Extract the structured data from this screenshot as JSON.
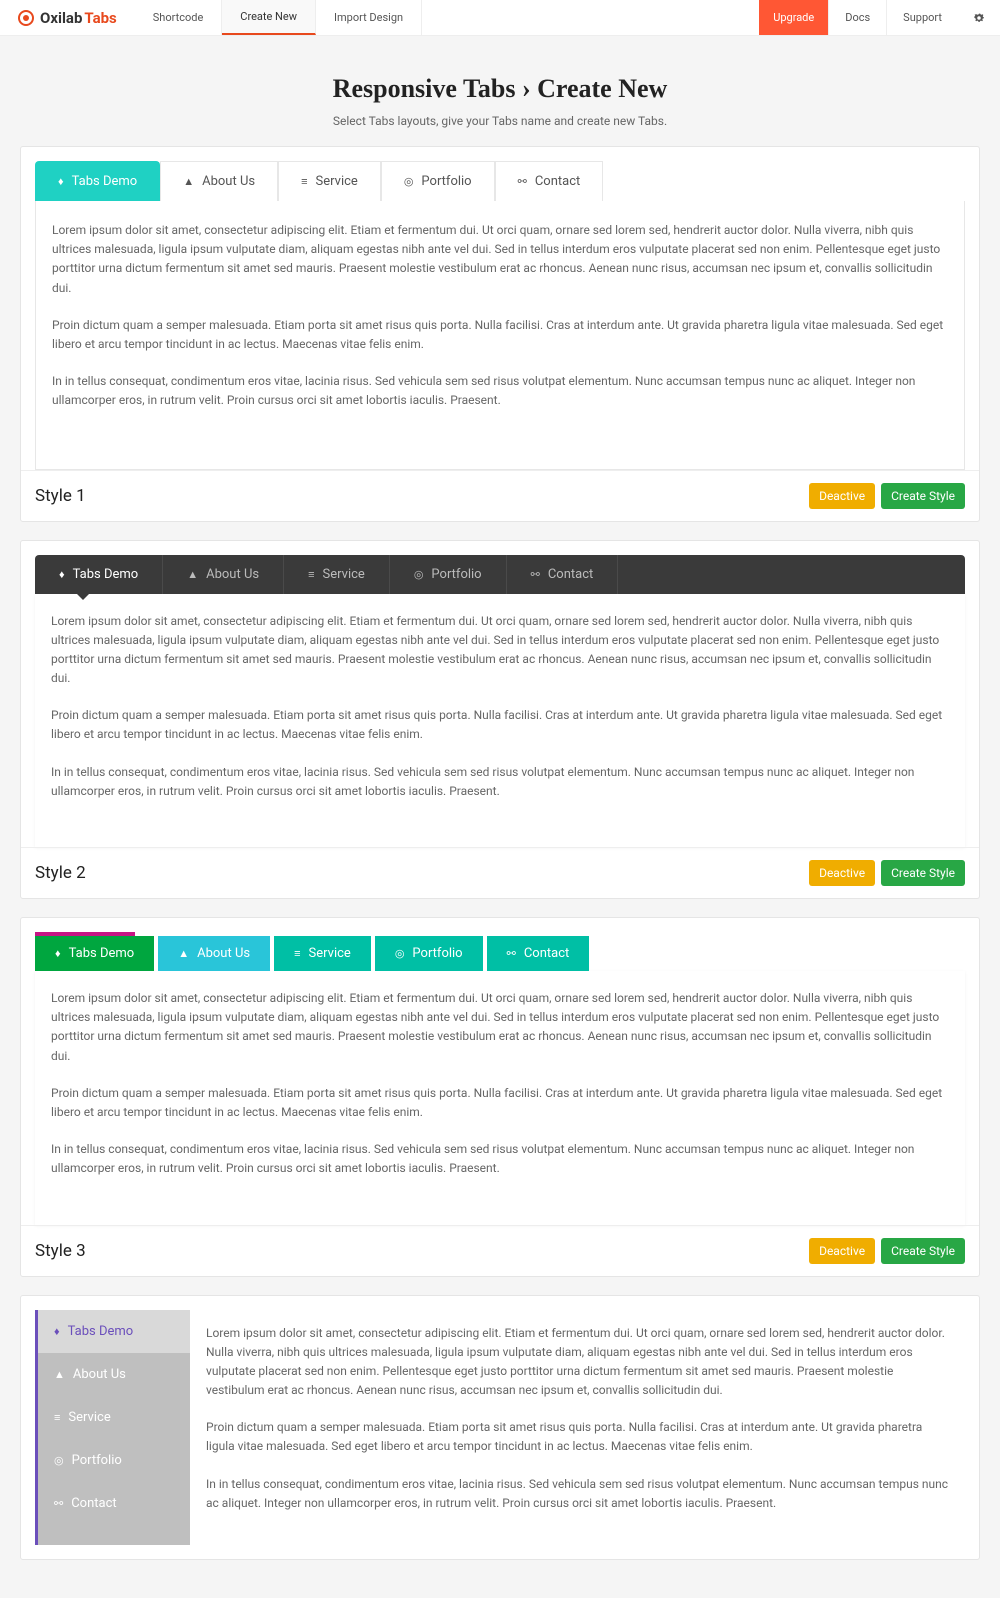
{
  "header": {
    "logo1": "Oxilab",
    "logo2": "Tabs",
    "nav": [
      "Shortcode",
      "Create New",
      "Import Design"
    ],
    "active_nav": 1,
    "upgrade": "Upgrade",
    "right": [
      "Docs",
      "Support"
    ]
  },
  "page": {
    "title": "Responsive Tabs › Create New",
    "subtitle": "Select Tabs layouts, give your Tabs name and create new Tabs."
  },
  "tabs": [
    "Tabs Demo",
    "About Us",
    "Service",
    "Portfolio",
    "Contact"
  ],
  "content": {
    "p1": "Lorem ipsum dolor sit amet, consectetur adipiscing elit. Etiam et fermentum dui. Ut orci quam, ornare sed lorem sed, hendrerit auctor dolor. Nulla viverra, nibh quis ultrices malesuada, ligula ipsum vulputate diam, aliquam egestas nibh ante vel dui. Sed in tellus interdum eros vulputate placerat sed non enim. Pellentesque eget justo porttitor urna dictum fermentum sit amet sed mauris. Praesent molestie vestibulum erat ac rhoncus. Aenean nunc risus, accumsan nec ipsum et, convallis sollicitudin dui.",
    "p2": "Proin dictum quam a semper malesuada. Etiam porta sit amet risus quis porta. Nulla facilisi. Cras at interdum ante. Ut gravida pharetra ligula vitae malesuada. Sed eget libero et arcu tempor tincidunt in ac lectus. Maecenas vitae felis enim.",
    "p3": "In in tellus consequat, condimentum eros vitae, lacinia risus. Sed vehicula sem sed risus volutpat elementum. Nunc accumsan tempus nunc ac aliquet. Integer non ullamcorper eros, in rutrum velit. Proin cursus orci sit amet lobortis iaculis. Praesent."
  },
  "styles": [
    "Style 1",
    "Style 2",
    "Style 3"
  ],
  "buttons": {
    "deactive": "Deactive",
    "create": "Create Style"
  }
}
